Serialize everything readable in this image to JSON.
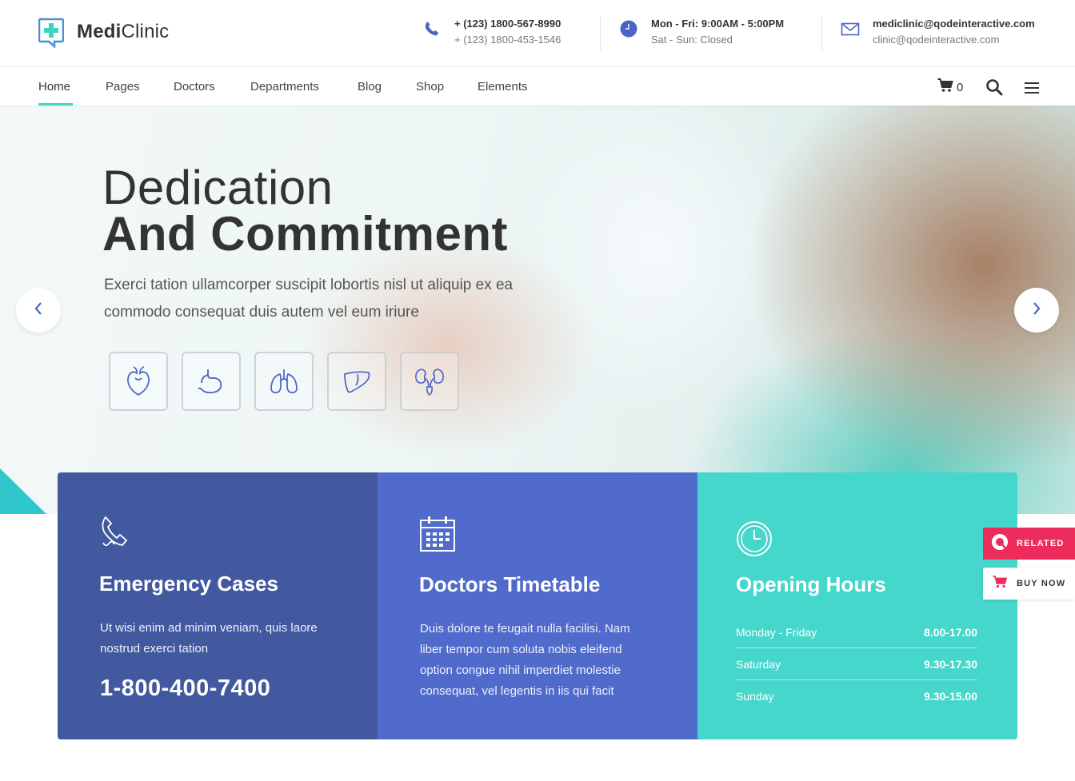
{
  "brand": {
    "name_bold": "Medi",
    "name_light": "Clinic"
  },
  "contacts": {
    "phone": {
      "line1": "+ (123) 1800-567-8990",
      "line2": "+ (123) 1800-453-1546",
      "icon": "phone-icon"
    },
    "hours": {
      "line1": "Mon - Fri: 9:00AM - 5:00PM",
      "line2": "Sat - Sun: Closed",
      "icon": "clock-icon"
    },
    "email": {
      "line1": "mediclinic@qodeinteractive.com",
      "line2": "clinic@qodeinteractive.com",
      "icon": "mail-icon"
    }
  },
  "nav": {
    "items": [
      "Home",
      "Pages",
      "Doctors",
      "Departments",
      "Blog",
      "Shop",
      "Elements"
    ],
    "active": "Home",
    "cart_count": "0"
  },
  "hero": {
    "title_line1": "Dedication",
    "title_line2": "And Commitment",
    "subtitle": "Exerci tation ullamcorper suscipit lobortis nisl ut aliquip ex ea commodo consequat duis autem vel eum iriure",
    "organ_icons": [
      "heart-icon",
      "stomach-icon",
      "lungs-icon",
      "liver-icon",
      "kidneys-icon"
    ]
  },
  "cards": {
    "emergency": {
      "title": "Emergency Cases",
      "text": "Ut wisi enim ad minim veniam, quis laore nostrud exerci tation",
      "phone": "1-800-400-7400"
    },
    "timetable": {
      "title": "Doctors Timetable",
      "text": "Duis dolore te feugait nulla facilisi. Nam liber tempor cum soluta nobis eleifend option congue nihil imperdiet molestie consequat, vel legentis in iis qui facit"
    },
    "opening": {
      "title": "Opening Hours",
      "rows": [
        {
          "day": "Monday - Friday",
          "time": "8.00-17.00"
        },
        {
          "day": "Saturday",
          "time": "9.30-17.30"
        },
        {
          "day": "Sunday",
          "time": "9.30-15.00"
        }
      ]
    }
  },
  "side": {
    "related": "RELATED",
    "buy_now": "BUY NOW"
  },
  "colors": {
    "accent": "#3fd3c6",
    "card_blue_dark": "#42599f",
    "card_blue": "#506bcb",
    "card_teal": "#45d6cc",
    "related_red": "#ee2c5b",
    "icon_blue": "#4a63c8"
  }
}
